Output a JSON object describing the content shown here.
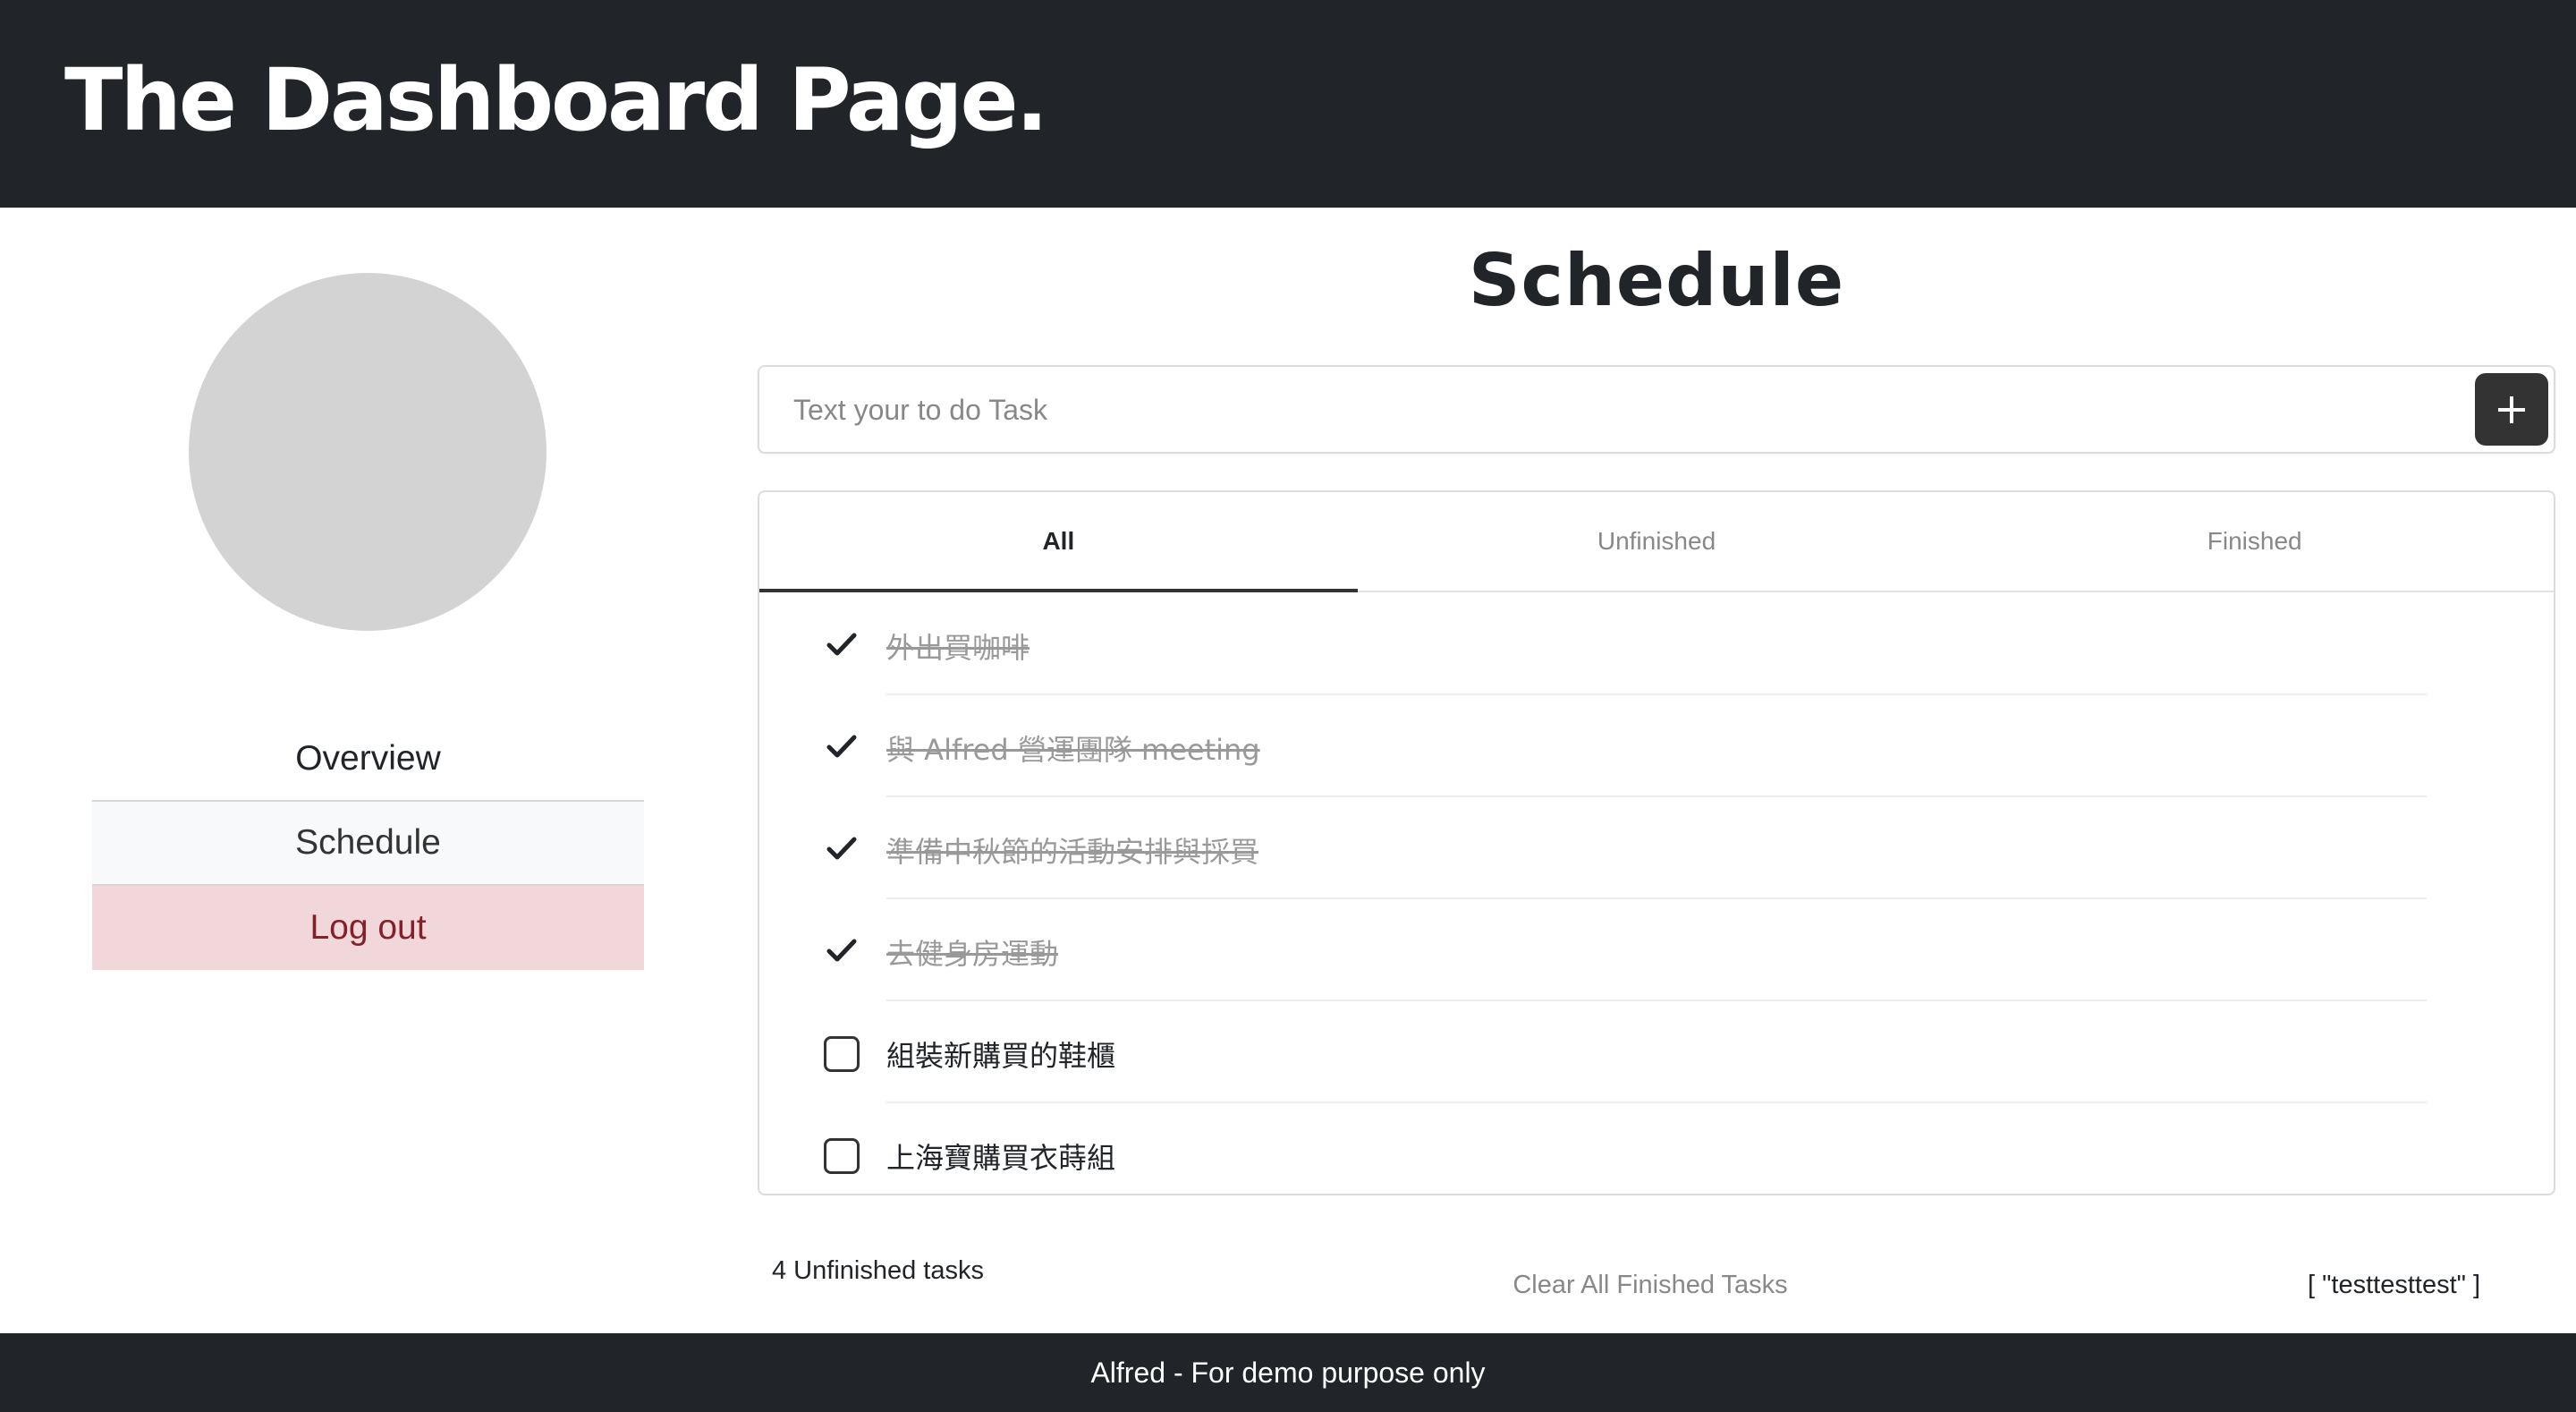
{
  "header": {
    "title": "The Dashboard Page."
  },
  "sidebar": {
    "items": [
      {
        "label": "Overview"
      },
      {
        "label": "Schedule"
      },
      {
        "label": "Log out"
      }
    ]
  },
  "main": {
    "title": "Schedule",
    "input": {
      "placeholder": "Text your to do Task",
      "value": ""
    },
    "add_icon": "plus-icon",
    "tabs": [
      {
        "label": "All",
        "active": true
      },
      {
        "label": "Unfinished",
        "active": false
      },
      {
        "label": "Finished",
        "active": false
      }
    ],
    "tasks": [
      {
        "label": "外出買咖啡",
        "done": true
      },
      {
        "label": "與 Alfred 營運團隊 meeting",
        "done": true
      },
      {
        "label": "準備中秋節的活動安排與採買",
        "done": true
      },
      {
        "label": "去健身房運動",
        "done": true
      },
      {
        "label": "組裝新購買的鞋櫃",
        "done": false
      },
      {
        "label": "上海寶購買衣蒔組",
        "done": false
      }
    ],
    "unfinished_count": "4 Unfinished tasks",
    "clear_label": "Clear All Finished Tasks",
    "user_tag": "[ \"testtesttest\" ]"
  },
  "footer": {
    "text": "Alfred - For demo purpose only"
  },
  "colors": {
    "header_bg": "#212529",
    "avatar": "#d3d3d3",
    "logout_bg": "#f2d7da",
    "logout_text": "#842029",
    "done_text": "#999999"
  }
}
